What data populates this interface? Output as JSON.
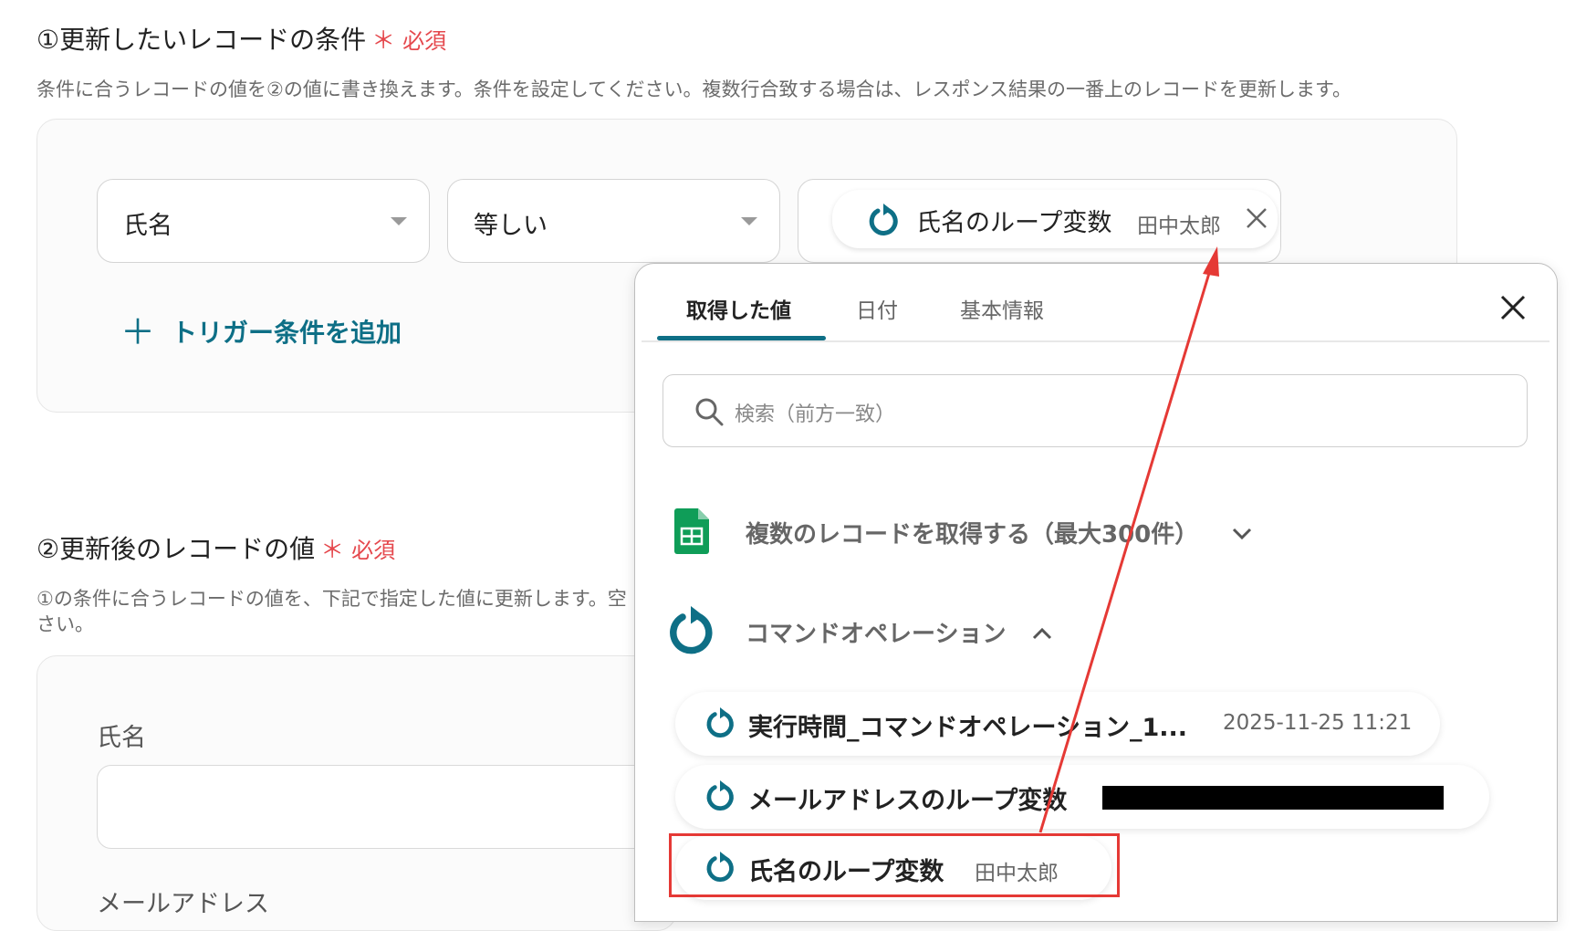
{
  "section1": {
    "title": "①更新したいレコードの条件",
    "required_mark": "＊",
    "required_label": "必須",
    "description": "条件に合うレコードの値を②の値に書き換えます。条件を設定してください。複数行合致する場合は、レスポンス結果の一番上のレコードを更新します。",
    "condition": {
      "field_value": "氏名",
      "operator_value": "等しい",
      "chip_label": "氏名のループ変数",
      "chip_value": "田中太郎"
    },
    "add_condition_label": "トリガー条件を追加"
  },
  "section2": {
    "title": "②更新後のレコードの値",
    "required_mark": "＊",
    "required_label": "必須",
    "description_line1": "①の条件に合うレコードの値を、下記で指定した値に更新します。空",
    "description_line2": "さい。",
    "fields": [
      {
        "label": "氏名",
        "value": ""
      },
      {
        "label": "メールアドレス"
      }
    ]
  },
  "popup": {
    "tabs": [
      {
        "label": "取得した値",
        "active": true
      },
      {
        "label": "日付",
        "active": false
      },
      {
        "label": "基本情報",
        "active": false
      }
    ],
    "search_placeholder": "検索（前方一致）",
    "groups": [
      {
        "label": "複数のレコードを取得する（最大300件）",
        "icon": "google-sheets-icon",
        "expanded": false
      },
      {
        "label": "コマンドオペレーション",
        "icon": "loop-icon",
        "expanded": true
      }
    ],
    "items": [
      {
        "label": "実行時間_コマンドオペレーション_1...",
        "value": "2025-11-25 11:21"
      },
      {
        "label": "メールアドレスのループ変数",
        "value": "[redacted]"
      },
      {
        "label": "氏名のループ変数",
        "value": "田中太郎"
      }
    ]
  },
  "colors": {
    "accent": "#0e6f86",
    "required": "#e5484d",
    "annotation": "#e53935",
    "sheets_green": "#0f9d58"
  }
}
